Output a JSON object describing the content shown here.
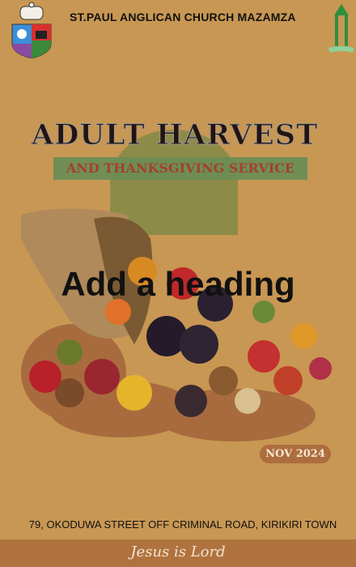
{
  "header": {
    "church_name": "ST.PAUL ANGLICAN CHURCH MAZAMZA"
  },
  "event": {
    "title": "ADULT HARVEST",
    "subtitle": "AND THANKSGIVING SERVICE",
    "heading_placeholder": "Add a heading",
    "date": "NOV 2024"
  },
  "address": "79, OKODUWA STREET OFF CRIMINAL ROAD, KIRIKIRI TOWN",
  "footer": {
    "motto": "Jesus is Lord"
  },
  "colors": {
    "background": "#c89753",
    "accent": "#ad6d3d",
    "band": "#6d8d55"
  }
}
